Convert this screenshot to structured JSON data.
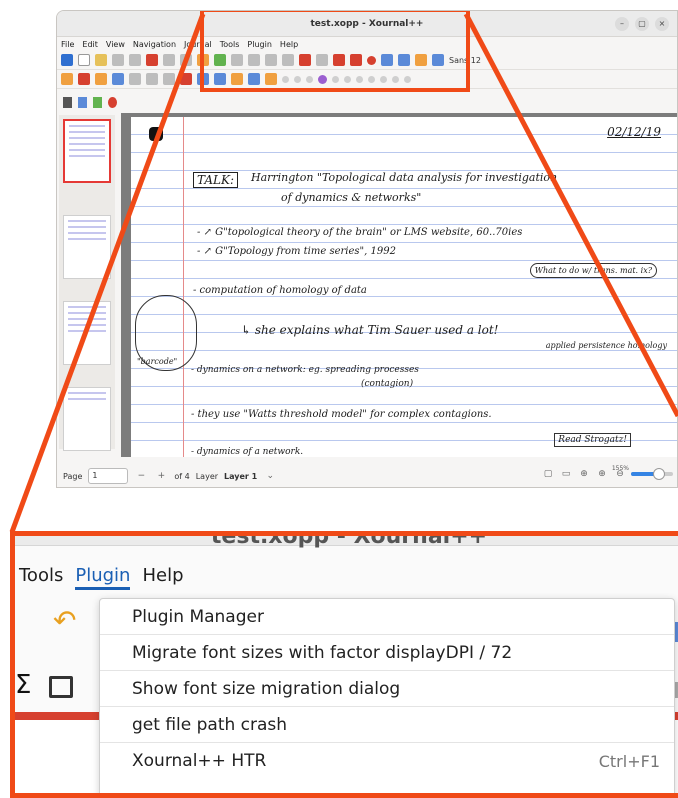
{
  "window": {
    "title": "test.xopp - Xournal++",
    "controls": [
      "–",
      "▢",
      "×"
    ]
  },
  "menubar": {
    "items": [
      "File",
      "Edit",
      "View",
      "Navigation",
      "Journal",
      "Tools",
      "Plugin",
      "Help"
    ]
  },
  "toolbar": {
    "font_label": "Sans 12"
  },
  "notes": {
    "date": "02/12/19",
    "talk": "TALK:",
    "line1": "Harrington \"Topological data analysis for investigation",
    "line1b": "of dynamics & networks\"",
    "line2": "- ↗ G\"topological theory of the brain\" or LMS website, 60..70ies",
    "line3": "- ↗ G\"Topology from time series\", 1992",
    "line4": "- computation of homology of data",
    "line5": "↳ she explains what Tim Sauer used a lot!",
    "line6": "- dynamics on a network: eg. spreading processes",
    "line6b": "(contagion)",
    "line7": "- they use \"Watts threshold model\" for complex contagions.",
    "line8": "- dynamics of a network.",
    "note1": "What to do w/ trans. mat. ix?",
    "note2": "applied persistence homology",
    "note3": "Read Strogatz!",
    "barcode": "\"barcode\""
  },
  "statusbar": {
    "page_label": "Page",
    "page_value": "1",
    "page_of": "of 4",
    "layer_label": "Layer",
    "layer_value": "Layer 1",
    "zoom_label": "155%"
  },
  "zoom": {
    "title": "test.xopp - Xournal++",
    "menu": [
      "Tools",
      "Plugin",
      "Help"
    ],
    "active_menu": "Plugin"
  },
  "plugin_menu": {
    "items": [
      {
        "label": "Plugin Manager",
        "accel": ""
      },
      {
        "label": "Migrate font sizes with factor displayDPI / 72",
        "accel": ""
      },
      {
        "label": "Show font size migration dialog",
        "accel": ""
      },
      {
        "label": "get file path crash",
        "accel": ""
      },
      {
        "label": "Xournal++ HTR",
        "accel": "Ctrl+F1"
      }
    ]
  },
  "colors": {
    "highlight": "#f04a17",
    "active_menu": "#1a5fb4",
    "ruling": "#b9c8ee"
  }
}
